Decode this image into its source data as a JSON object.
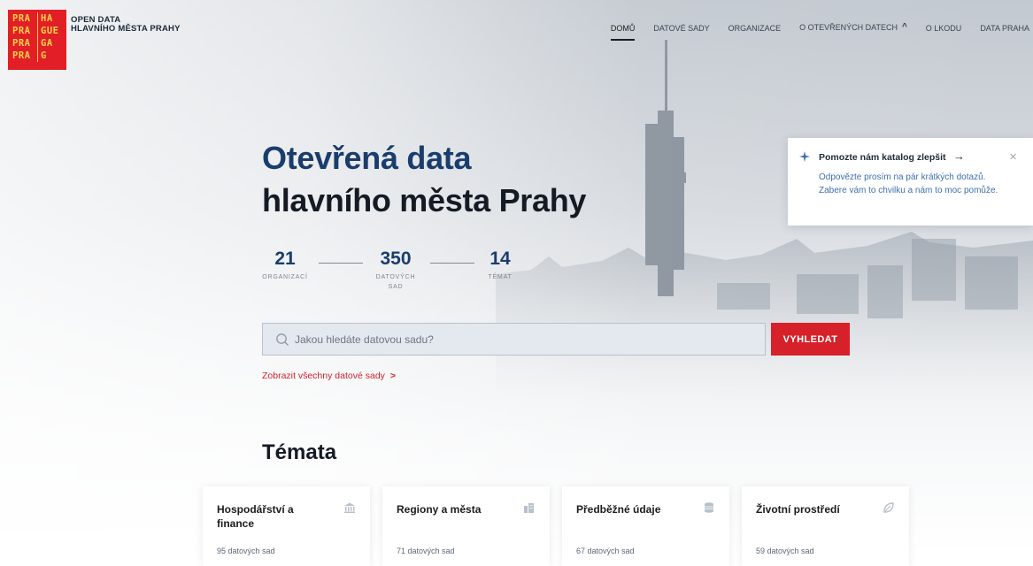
{
  "logo": {
    "cells": [
      "PRA",
      "HA",
      "PRA",
      "GUE",
      "PRA",
      "GA",
      "PRA",
      "G"
    ]
  },
  "brand": {
    "line1": "OPEN DATA",
    "line2": "HLAVNÍHO MĚSTA PRAHY"
  },
  "nav": {
    "items": [
      {
        "label": "DOMŮ",
        "active": true
      },
      {
        "label": "DATOVÉ SADY"
      },
      {
        "label": "ORGANIZACE"
      },
      {
        "label": "O OTEVŘENÝCH DATECH"
      },
      {
        "label": "O LKODU"
      },
      {
        "label": "DATA PRAHA"
      }
    ]
  },
  "hero": {
    "title_line1": "Otevřená data",
    "title_line2": "hlavního města Prahy"
  },
  "stats": [
    {
      "value": "21",
      "label1": "ORGANIZACÍ",
      "label2": ""
    },
    {
      "value": "350",
      "label1": "DATOVÝCH",
      "label2": "SAD"
    },
    {
      "value": "14",
      "label1": "TÉMAT",
      "label2": ""
    }
  ],
  "search": {
    "placeholder": "Jakou hledáte datovou sadu?",
    "button_label": "VYHLEDAT",
    "show_all_label": "Zobrazit všechny datové sady"
  },
  "topics": {
    "title": "Témata",
    "cards": [
      {
        "title": "Hospodářství a finance",
        "count": "95 datových sad",
        "icon": "bank-icon"
      },
      {
        "title": "Regiony a města",
        "count": "71 datových sad",
        "icon": "city-icon"
      },
      {
        "title": "Předběžné údaje",
        "count": "67 datových sad",
        "icon": "database-icon"
      },
      {
        "title": "Životní prostředí",
        "count": "59 datových sad",
        "icon": "leaf-icon"
      }
    ]
  },
  "popup": {
    "title": "Pomozte nám katalog zlepšit",
    "body": "Odpovězte prosím na pár krátkých dotazů. Zabere vám to chvilku a nám to moc pomůže."
  },
  "colors": {
    "accent_red": "#d6202a",
    "brand_blue": "#1a3d6d",
    "link_blue": "#3f6fae"
  }
}
